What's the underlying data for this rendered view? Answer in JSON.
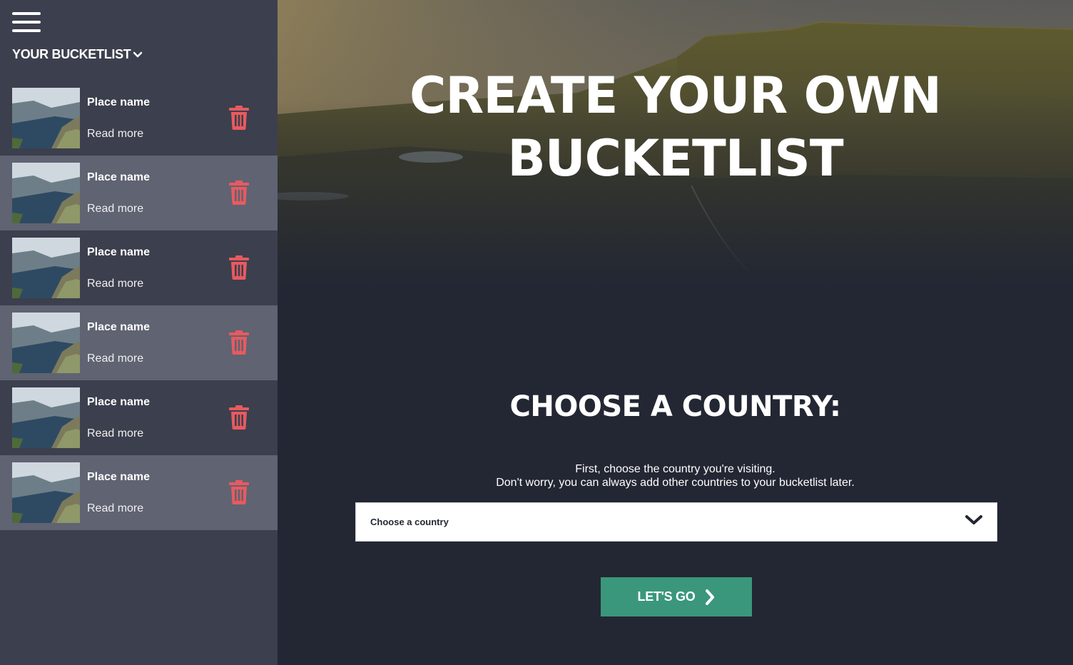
{
  "sidebar": {
    "title": "YOUR BUCKETLIST",
    "items": [
      {
        "name": "Place name",
        "link": "Read more"
      },
      {
        "name": "Place name",
        "link": "Read more"
      },
      {
        "name": "Place name",
        "link": "Read more"
      },
      {
        "name": "Place name",
        "link": "Read more"
      },
      {
        "name": "Place name",
        "link": "Read more"
      },
      {
        "name": "Place name",
        "link": "Read more"
      }
    ]
  },
  "hero": {
    "line1": "CREATE YOUR OWN",
    "line2": "BUCKETLIST"
  },
  "country_section": {
    "heading": "CHOOSE A COUNTRY:",
    "intro_line1": "First, choose the country you're visiting.",
    "intro_line2": "Don't worry, you can always add other countries to your bucketlist later.",
    "select_value": "Choose a country",
    "button_label": "LET'S GO"
  },
  "colors": {
    "sidebar_bg": "#3c3f4d",
    "sidebar_alt_row": "#5f6372",
    "main_bg": "#232733",
    "trash_red": "#e85a5f",
    "button_green": "#3a977b"
  },
  "icons": {
    "menu": "hamburger-icon",
    "dropdown": "chevron-down-icon",
    "delete": "trash-icon",
    "go": "chevron-right-icon"
  }
}
